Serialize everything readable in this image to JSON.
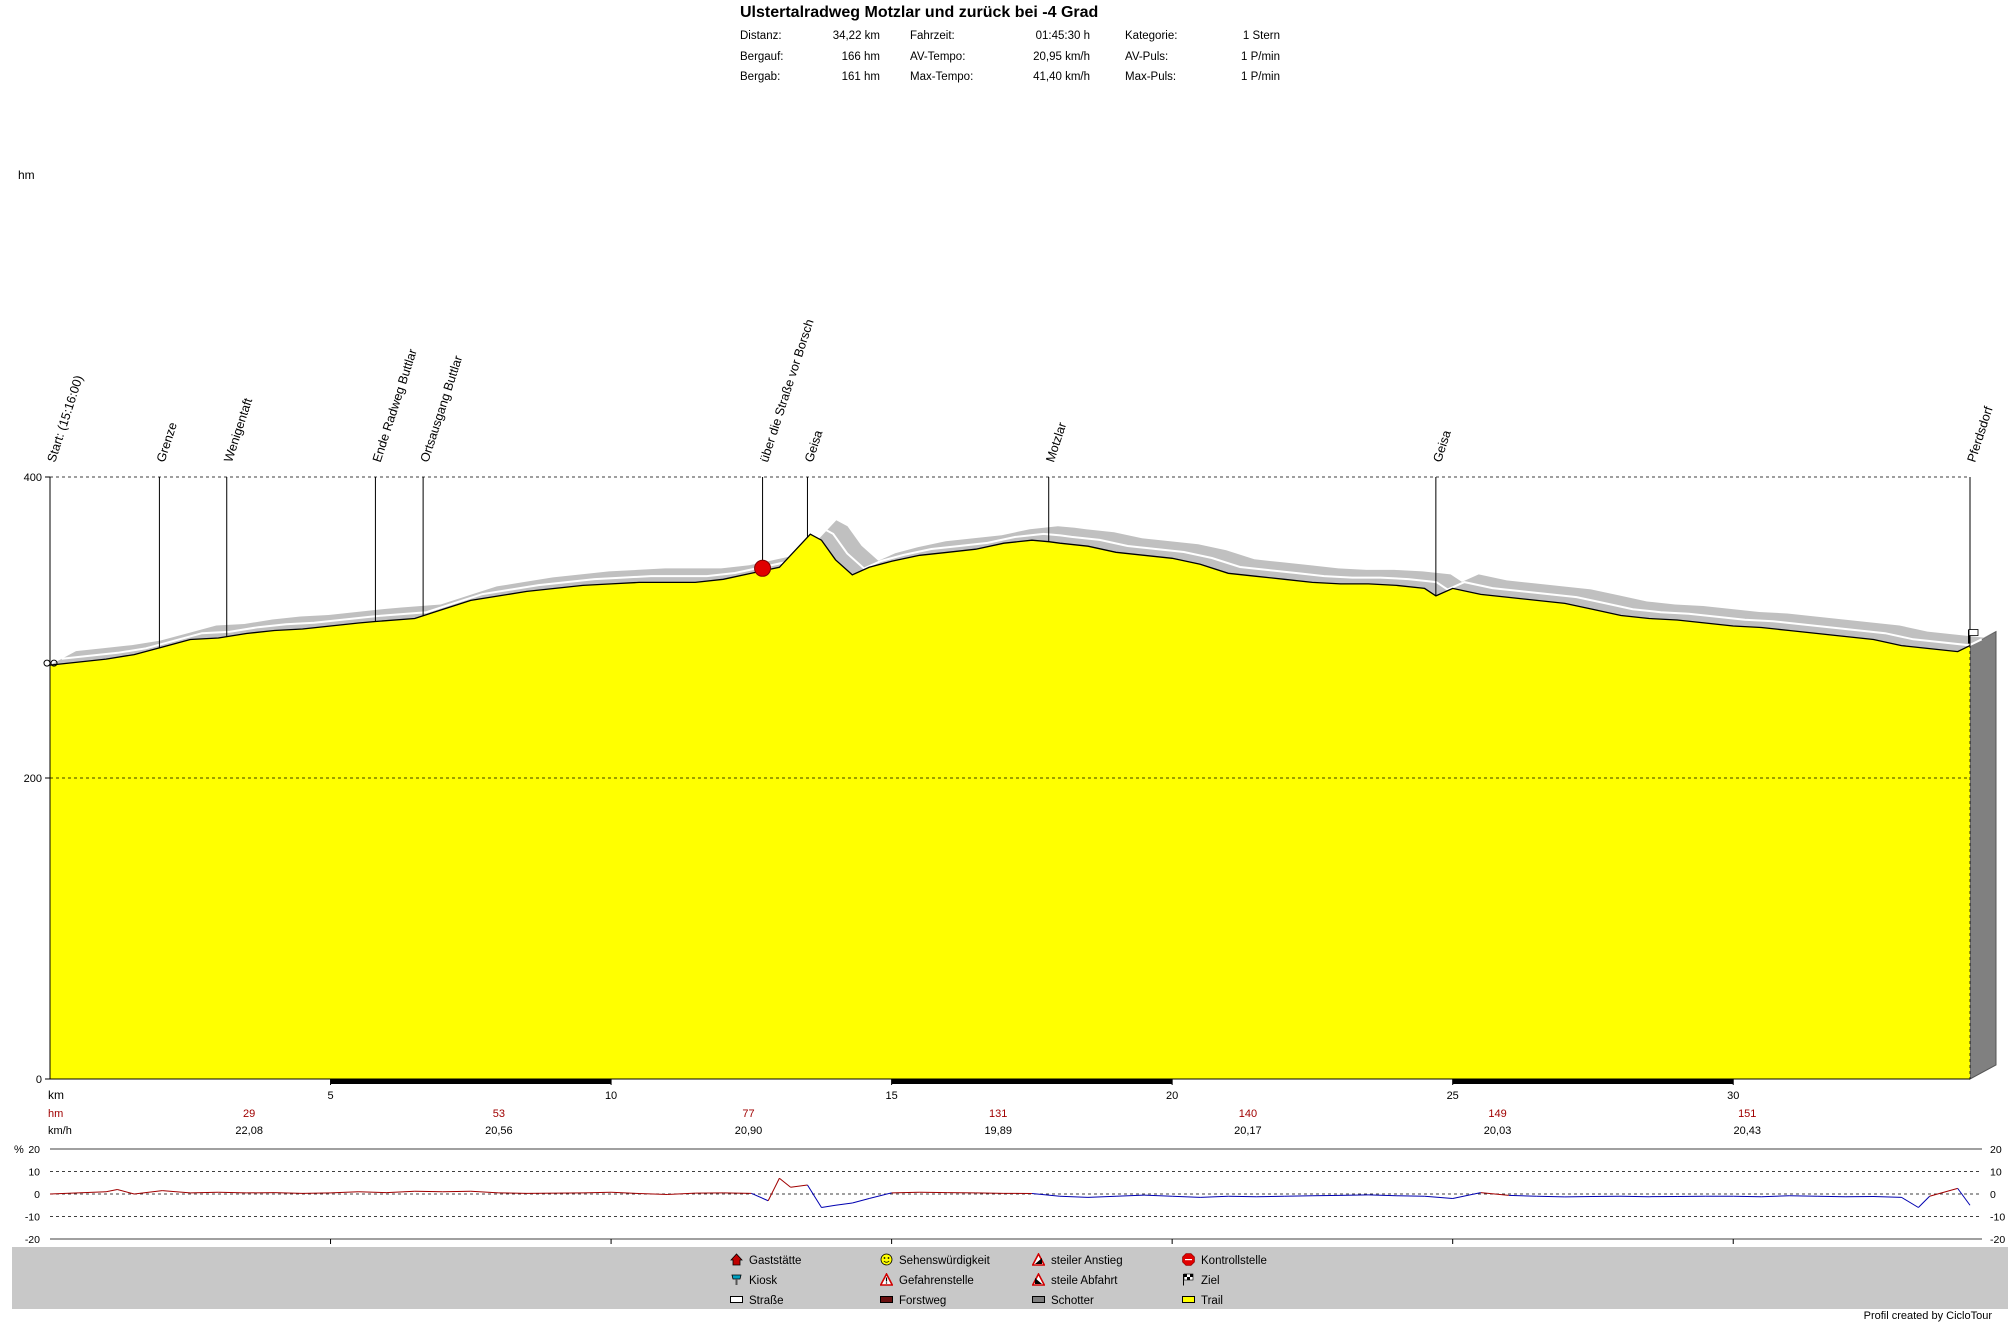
{
  "header": {
    "title": "Ulstertalradweg Motzlar und zurück bei -4 Grad",
    "stats": [
      {
        "label": "Distanz:",
        "value": "34,22 km"
      },
      {
        "label": "Bergauf:",
        "value": "166 hm"
      },
      {
        "label": "Bergab:",
        "value": "161 hm"
      },
      {
        "label": "Fahrzeit:",
        "value": "01:45:30 h"
      },
      {
        "label": "AV-Tempo:",
        "value": "20,95 km/h"
      },
      {
        "label": "Max-Tempo:",
        "value": "41,40 km/h"
      },
      {
        "label": "Kategorie:",
        "value": "1 Stern"
      },
      {
        "label": "AV-Puls:",
        "value": "1 P/min"
      },
      {
        "label": "Max-Puls:",
        "value": "1 P/min"
      }
    ]
  },
  "chart_data": [
    {
      "type": "area",
      "ylabel": "hm",
      "xlabel": "km",
      "xlim": [
        0,
        34.22
      ],
      "ylim": [
        0,
        400
      ],
      "y_ticks": [
        0,
        200,
        400
      ],
      "x_ticks": [
        5,
        10,
        15,
        20,
        25,
        30
      ],
      "colors": {
        "fill": "#ffff00",
        "shadow": "#c0c0c0",
        "line": "#000000"
      },
      "series": [
        {
          "x": [
            0,
            0.5,
            1.0,
            1.5,
            2.0,
            2.5,
            3.0,
            3.5,
            4.0,
            4.5,
            5.0,
            5.5,
            5.8,
            6.5,
            7.0,
            7.5,
            8.0,
            8.5,
            9.0,
            9.5,
            10.0,
            10.5,
            11.0,
            11.5,
            12.0,
            12.5,
            12.75,
            13.0,
            13.55,
            13.75,
            14.0,
            14.3,
            14.6,
            15.0,
            15.5,
            16.0,
            16.5,
            17.0,
            17.5,
            17.8,
            18.0,
            18.5,
            19.0,
            19.5,
            20.0,
            20.5,
            21.0,
            21.5,
            22.0,
            22.5,
            23.0,
            23.5,
            24.0,
            24.5,
            24.7,
            25.0,
            25.5,
            26.0,
            26.5,
            27.0,
            27.5,
            28.0,
            28.5,
            29.0,
            29.5,
            30.0,
            30.5,
            31.0,
            31.5,
            32.0,
            32.5,
            33.0,
            33.5,
            34.0,
            34.22
          ],
          "y": [
            275,
            277,
            279,
            282,
            287,
            292,
            293,
            296,
            298,
            299,
            301,
            303,
            304,
            306,
            312,
            318,
            321,
            324,
            326,
            328,
            329,
            330,
            330,
            330,
            332,
            336,
            338,
            340,
            362,
            358,
            345,
            335,
            340,
            344,
            348,
            350,
            352,
            356,
            358,
            357,
            356,
            354,
            350,
            348,
            346,
            342,
            336,
            334,
            332,
            330,
            329,
            329,
            328,
            326,
            321,
            326,
            322,
            320,
            318,
            316,
            312,
            308,
            306,
            305,
            303,
            301,
            300,
            298,
            296,
            294,
            292,
            288,
            286,
            284,
            288
          ]
        }
      ],
      "waypoints": [
        {
          "km": 0.0,
          "label": "Start: (15:16:00)"
        },
        {
          "km": 1.95,
          "label": "Grenze"
        },
        {
          "km": 3.15,
          "label": "Wenigentaft"
        },
        {
          "km": 5.8,
          "label": "Ende Radweg Buttlar"
        },
        {
          "km": 6.65,
          "label": "Ortsausgang Buttlar"
        },
        {
          "km": 12.7,
          "label": "über die Straße vor Borsch"
        },
        {
          "km": 13.5,
          "label": "Geisa"
        },
        {
          "km": 17.8,
          "label": "Motzlar"
        },
        {
          "km": 24.7,
          "label": "Geisa"
        },
        {
          "km": 34.22,
          "label": "Pferdsdorf"
        }
      ],
      "segments": [
        {
          "key": "hm",
          "key_color": "#a00000",
          "values": [
            "29",
            "53",
            "77",
            "131",
            "140",
            "149",
            "151"
          ],
          "km": [
            3.55,
            8.0,
            12.45,
            16.9,
            21.35,
            25.8,
            30.25
          ]
        },
        {
          "key": "km/h",
          "key_color": "#000000",
          "values": [
            "22,08",
            "20,56",
            "20,90",
            "19,89",
            "20,17",
            "20,03",
            "20,43"
          ],
          "km": [
            3.55,
            8.0,
            12.45,
            16.9,
            21.35,
            25.8,
            30.25
          ]
        }
      ]
    },
    {
      "type": "line",
      "ylabel": "%",
      "ylim": [
        -20,
        20
      ],
      "y_ticks": [
        -20,
        -10,
        0,
        10,
        20
      ],
      "series": [
        {
          "x": [
            0,
            0.5,
            1.0,
            1.2,
            1.5,
            2.0,
            2.5,
            3.0,
            3.5,
            4.0,
            4.5,
            5.0,
            5.5,
            6.0,
            6.5,
            7.0,
            7.5,
            8.0,
            8.5,
            9.0,
            9.5,
            10.0,
            10.5,
            11.0,
            11.5,
            12.0,
            12.5,
            12.8,
            13.0,
            13.2,
            13.5,
            13.75,
            14.0,
            14.3,
            14.6,
            15.0,
            15.5,
            16.0,
            16.5,
            17.0,
            17.5,
            18.0,
            18.5,
            19.0,
            19.5,
            20.0,
            20.5,
            21.0,
            21.5,
            22.0,
            22.5,
            23.0,
            23.5,
            24.0,
            24.5,
            25.0,
            25.5,
            26.0,
            26.5,
            27.0,
            27.5,
            28.0,
            28.5,
            29.0,
            29.5,
            30.0,
            30.5,
            31.0,
            31.5,
            32.0,
            32.5,
            33.0,
            33.3,
            33.5,
            34.0,
            34.22
          ],
          "y": [
            0,
            0.5,
            1,
            2,
            0,
            1.5,
            0.5,
            0.8,
            0.5,
            0.6,
            0.3,
            0.5,
            1,
            0.6,
            1.2,
            1,
            1.2,
            0.5,
            0.3,
            0.4,
            0.5,
            0.8,
            0.2,
            -0.2,
            0.4,
            0.5,
            0.3,
            -3,
            7,
            3,
            4,
            -6,
            -5,
            -4,
            -2,
            0.5,
            0.8,
            0.6,
            0.5,
            0.3,
            0.2,
            -1,
            -1.5,
            -1,
            -0.5,
            -1,
            -1.5,
            -1,
            -1.2,
            -1,
            -0.8,
            -0.6,
            -0.4,
            -0.8,
            -1,
            -2,
            0.6,
            -0.6,
            -1,
            -1.3,
            -1.1,
            -1,
            -1.2,
            -1.1,
            -1,
            -1,
            -1.2,
            -0.8,
            -1,
            -1.2,
            -1.1,
            -1.5,
            -6,
            -1,
            2.5,
            -5
          ]
        }
      ]
    }
  ],
  "legend": [
    {
      "label": "Gaststätte",
      "icon": "house-icon"
    },
    {
      "label": "Kiosk",
      "icon": "kiosk-icon"
    },
    {
      "label": "Straße",
      "icon": "road-swatch"
    },
    {
      "label": "Sehenswürdigkeit",
      "icon": "smiley-icon"
    },
    {
      "label": "Gefahrenstelle",
      "icon": "warning-icon"
    },
    {
      "label": "Forstweg",
      "icon": "forest-road-swatch"
    },
    {
      "label": "steiler Anstieg",
      "icon": "steep-climb-icon"
    },
    {
      "label": "steile Abfahrt",
      "icon": "steep-descent-icon"
    },
    {
      "label": "Schotter",
      "icon": "gravel-swatch"
    },
    {
      "label": "Kontrollstelle",
      "icon": "stop-icon"
    },
    {
      "label": "Ziel",
      "icon": "finish-flag-icon"
    },
    {
      "label": "Trail",
      "icon": "trail-swatch"
    }
  ],
  "credit": "Profil created by CicloTour"
}
